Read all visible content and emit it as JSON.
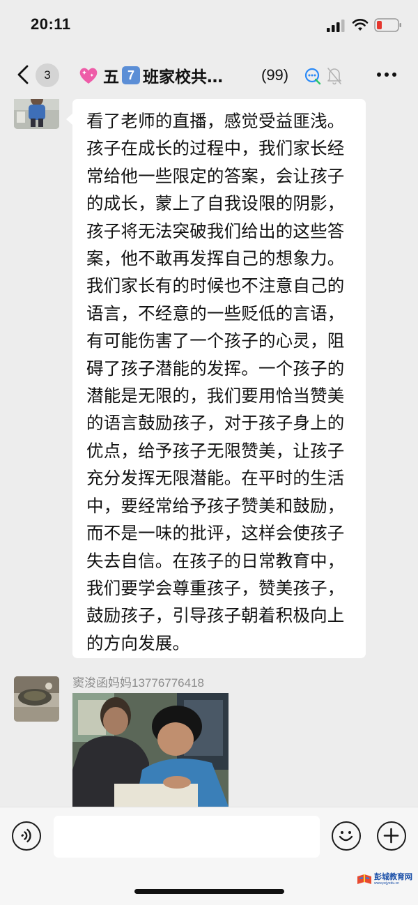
{
  "status_bar": {
    "time": "20:11"
  },
  "nav": {
    "unread_count": "3",
    "title_part1": "五",
    "title_badge": "7",
    "title_part2": "班家校共…",
    "member_count": "(99)",
    "icons": [
      "back-icon",
      "group-assistant-icon",
      "mute-icon",
      "more-icon"
    ]
  },
  "messages": [
    {
      "type": "text",
      "text": "看了老师的直播，感觉受益匪浅。孩子在成长的过程中，我们家长经常给他一些限定的答案，会让孩子的成长，蒙上了自我设限的阴影，孩子将无法突破我们给出的这些答案，他不敢再发挥自己的想象力。我们家长有的时候也不注意自己的语言，不经意的一些贬低的言语，有可能伤害了一个孩子的心灵，阻碍了孩子潜能的发挥。一个孩子的潜能是无限的，我们要用恰当赞美的语言鼓励孩子，对于孩子身上的优点，给予孩子无限赞美，让孩子充分发挥无限潜能。在平时的生活中，要经常给予孩子赞美和鼓励，而不是一味的批评，这样会使孩子失去自信。在孩子的日常教育中，我们要学会尊重孩子，赞美孩子，鼓励孩子，引导孩子朝着积极向上的方向发展。"
    },
    {
      "type": "image",
      "sender": "窦浚函妈妈13776776418"
    }
  ],
  "input_bar": {
    "input_value": "",
    "icons": [
      "voice-icon",
      "emoji-icon",
      "plus-icon"
    ]
  },
  "watermark": {
    "name": "彭城教育网",
    "sub": "www.pcjyedu.cn"
  },
  "colors": {
    "background": "#ededed",
    "bubble": "#ffffff",
    "input_bar": "#f6f6f6",
    "sender_name": "#8c8c8c"
  }
}
